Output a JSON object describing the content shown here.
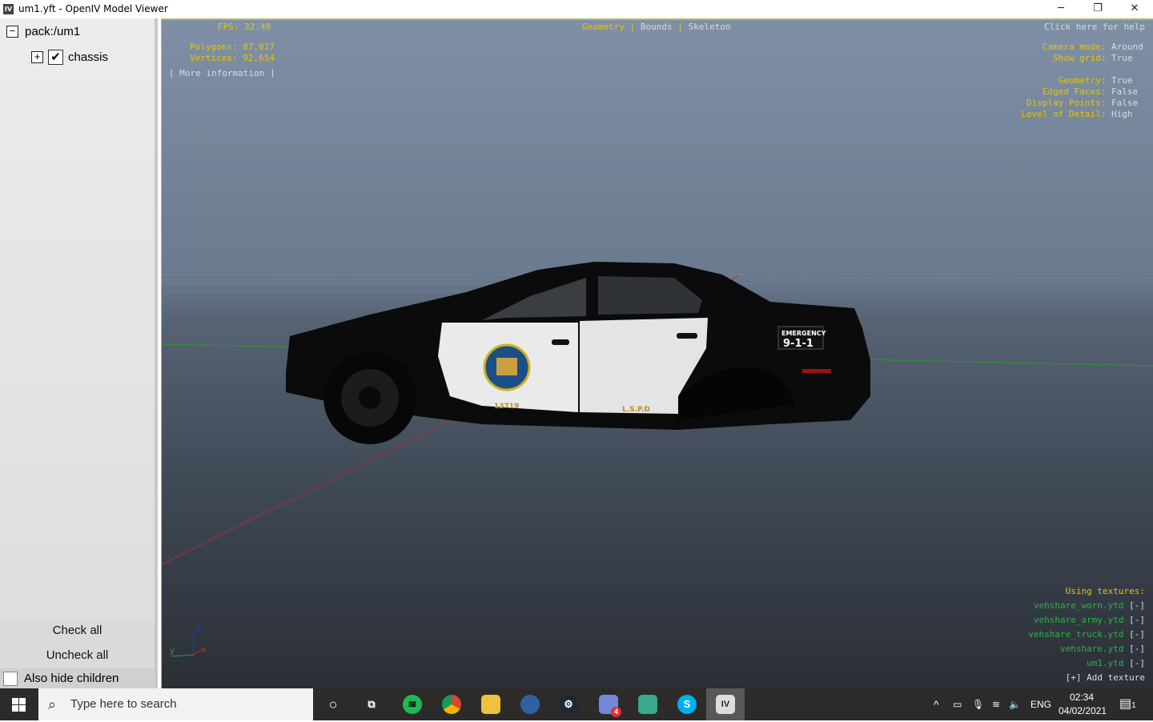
{
  "window": {
    "title": "um1.yft - OpenIV Model Viewer",
    "app_icon": "IV",
    "minimize": "─",
    "restore": "❐",
    "close": "✕"
  },
  "sidebar": {
    "root": "pack:/um1",
    "root_toggle": "−",
    "child": "chassis",
    "child_toggle": "+",
    "check_all": "Check all",
    "uncheck_all": "Uncheck all",
    "also_hide_children": "Also hide children"
  },
  "hud": {
    "fps": "FPS: 32.48",
    "polygons": "Polygons: 87,017",
    "vertices": "Vertices: 92,654",
    "more_info": "[ More information ]",
    "modes": {
      "geometry": "Geometry",
      "bounds": "Bounds",
      "skeleton": "Skeleton",
      "sep": "|"
    },
    "help": "Click here for help",
    "settings": [
      {
        "label": "Camera mode:",
        "value": "Around"
      },
      {
        "label": "Show grid:",
        "value": "True"
      },
      {
        "label": "Geometry:",
        "value": "True"
      },
      {
        "label": "Edged Faces:",
        "value": "False"
      },
      {
        "label": "Display Points:",
        "value": "False"
      },
      {
        "label": "Level of Detail:",
        "value": "High"
      }
    ],
    "textures_title": "Using textures:",
    "textures": [
      "vehshare_worn.ytd",
      "vehshare_army.ytd",
      "vehshare_truck.ytd",
      "vehshare.ytd",
      "um1.ytd"
    ],
    "remove": "[-]",
    "add_texture": "[+] Add texture",
    "axes": {
      "z": "z",
      "y": "y",
      "x": "x"
    }
  },
  "car": {
    "emergency": "EMERGENCY",
    "number": "9-1-1",
    "unit": "13719",
    "dept": "L.S.P.D"
  },
  "taskbar": {
    "search_placeholder": "Type here to search",
    "lang": "ENG",
    "time": "02:34",
    "date": "04/02/2021",
    "notifications": "1",
    "discord_badge": "4"
  }
}
